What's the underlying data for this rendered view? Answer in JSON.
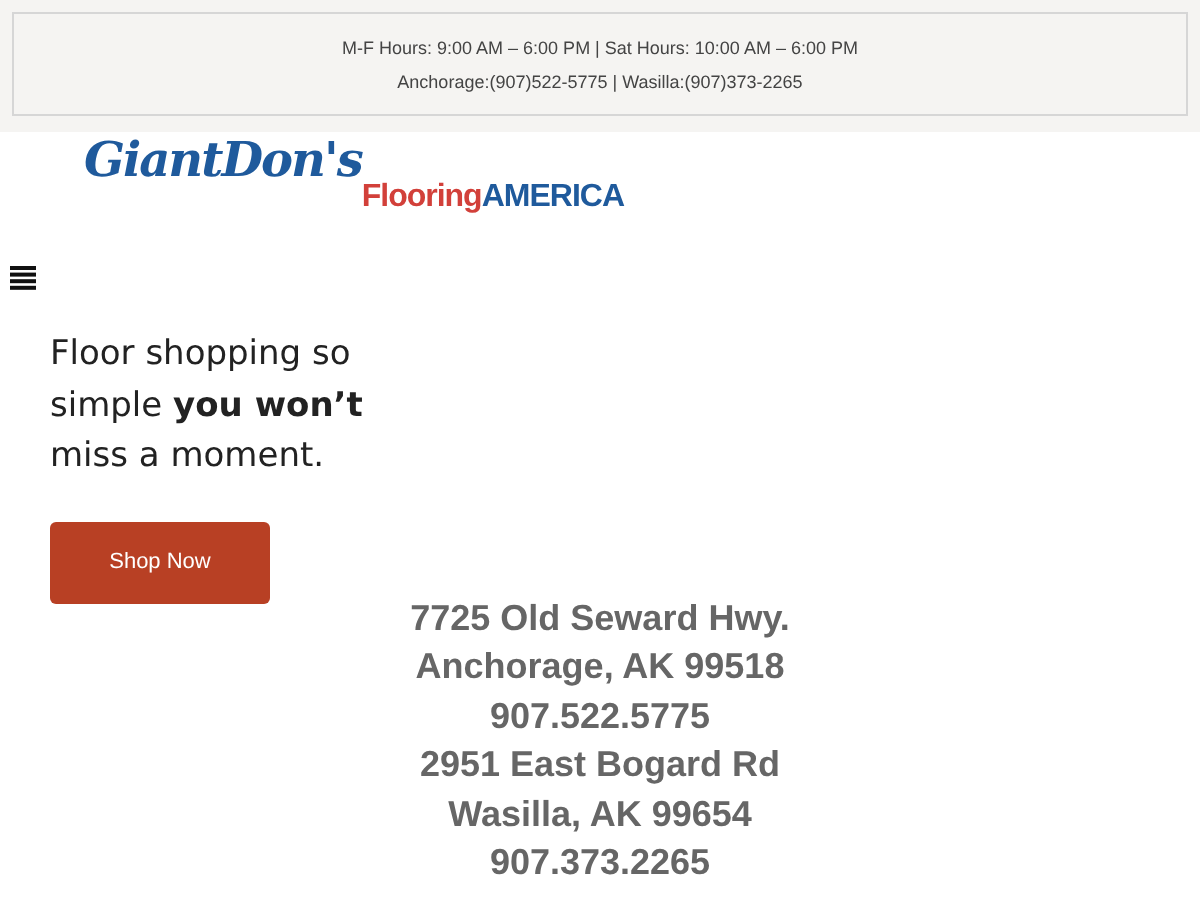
{
  "top_bar": {
    "lines": [
      "M-F Hours: 9:00 AM – 6:00 PM | Sat Hours: 10:00 AM – 6:00 PM",
      "Anchorage:(907)522-5775 | Wasilla:(907)373-2265"
    ]
  },
  "logo": {
    "name": "GiantDon's",
    "brand_1": "Flooring",
    "brand_2": "AMERICA"
  },
  "hero": {
    "headline": "Floor shopping so simple **you won’t** miss a moment.",
    "button": "Shop Now"
  },
  "address_lines": [
    "7725 Old Seward Hwy.",
    "Anchorage, AK 99518",
    "907.522.5775",
    "2951 East Bogard Rd",
    "Wasilla, AK 99654",
    "907.373.2265"
  ]
}
